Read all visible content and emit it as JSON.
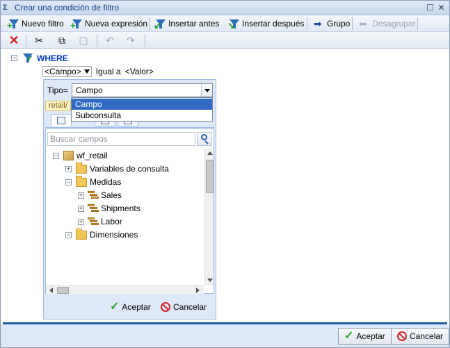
{
  "window": {
    "title": "Crear una condición de filtro",
    "title_icon": "Σ"
  },
  "toolbar": {
    "new_filter": "Nuevo filtro",
    "new_expression": "Nueva expresión",
    "insert_before": "Insertar antes",
    "insert_after": "Insertar después",
    "group": "Grupo",
    "ungroup": "Desagrupar"
  },
  "condition": {
    "root": "WHERE",
    "field": "<Campo>",
    "operator": "Igual a",
    "value": "<Valor>"
  },
  "popup": {
    "tipo_label": "Tipo=",
    "tipo_value": "Campo",
    "partial_tab": "retail/",
    "search_placeholder": "Buscar campos",
    "tree": [
      "wf_retail",
      "Variables de consulta",
      "Medidas",
      "Sales",
      "Shipments",
      "Labor",
      "Dimensiones"
    ],
    "ok": "Aceptar",
    "cancel": "Cancelar"
  },
  "dropdown": {
    "options": [
      "Campo",
      "Subconsulta"
    ],
    "selected": "Campo"
  },
  "footer": {
    "ok": "Aceptar",
    "cancel": "Cancelar"
  },
  "colors": {
    "accent": "#1f56a8",
    "selected": "#316ac5",
    "where": "#0033cc"
  }
}
